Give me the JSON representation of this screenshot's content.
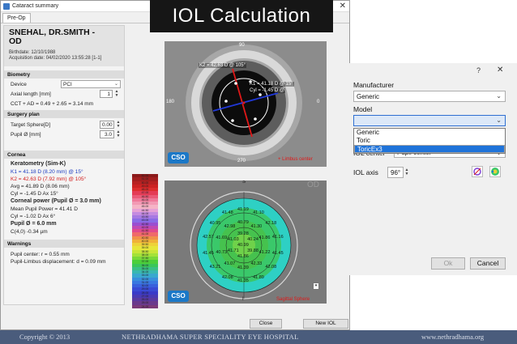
{
  "window": {
    "title": "Cataract summary",
    "close_glyph": "✕"
  },
  "tabs": [
    {
      "label": "Pre-Op"
    }
  ],
  "banner": {
    "text": "IOL Calculation"
  },
  "patient": {
    "name_line1": "SNEHAL, DR.SMITH -",
    "name_line2": "OD",
    "birthdate": "Birthdate: 12/10/1988",
    "acquisition": "Acquisition date: 04/02/2020 13:55:28 [1-1]"
  },
  "biometry": {
    "header": "Biometry",
    "device_label": "Device",
    "device_value": "PCI",
    "axial_label": "Axial length [mm]",
    "axial_value": "1",
    "cct_text": "CCT + AD = 0.49 + 2.65 = 3.14 mm"
  },
  "surgery": {
    "header": "Surgery plan",
    "target_label": "Target Sphere[D]",
    "target_value": "0.00",
    "pupil_label": "Pupil Ø [mm]",
    "pupil_value": "3.0"
  },
  "cornea": {
    "header": "Cornea",
    "keratometry_title": "Keratometry (Sim-K)",
    "k1": "K1 = 41.18 D (8.20 mm) @ 15°",
    "k2": "K2 = 42.63 D (7.92 mm) @ 105°",
    "avg": "Avg = 41.89 D (8.06 mm)",
    "cyl": "Cyl = -1.45 D Ax 15°",
    "corneal_power_title": "Corneal power (Pupil Ø = 3.0 mm)",
    "mean_pupil_power": "Mean Pupil Power = 41.41 D",
    "cyl2": "Cyl = -1.02 D Ax 6°",
    "pupil6_title": "Pupil Ø = 6.0 mm",
    "c40": "C(4,0) -0.34 µm"
  },
  "warnings": {
    "header": "Warnings",
    "pupil_center": "Pupil center: r = 0.55 mm",
    "pupil_limbus": "Pupil-Limbus displacement: d = 0.09 mm"
  },
  "top_image": {
    "k2_label": "K2 = 42.63 D @ 105°",
    "k1_label": "K1 = 41.18 D @ 15°",
    "cyl_label": "Cyl = -1.45 D @",
    "limbus_label": "+ Limbus center",
    "od_label": "OD",
    "ticks": {
      "t90": "90",
      "t0": "0",
      "t180": "180",
      "t270": "270"
    },
    "logo": "CSO"
  },
  "bottom_image": {
    "od_label": "OD",
    "sagittal_label": "Sagittal Sphere",
    "tick_top": "S",
    "tick_bottom": "I",
    "logo": "CSO",
    "map_values": [
      "40.99",
      "39.28",
      "40.24",
      "39.88",
      "41.86",
      "41.71",
      "41.03",
      "40.79",
      "41.30",
      "41.86",
      "41.22",
      "42.33",
      "41.39",
      "41.07",
      "40.73",
      "41.69",
      "42.98",
      "41.19",
      "41.10",
      "42.18",
      "41.16",
      "41.45",
      "42.08",
      "41.89",
      "41.35",
      "42.08",
      "43.21",
      "41.45",
      "42.57",
      "40.95",
      "41.48"
    ]
  },
  "scale": {
    "values": [
      "52.00",
      "51.00",
      "50.00",
      "49.00",
      "48.00",
      "47.00",
      "46.50",
      "46.00",
      "45.50",
      "45.00",
      "44.50",
      "44.00",
      "43.50",
      "43.00",
      "42.50",
      "42.00",
      "41.50",
      "41.00",
      "40.50",
      "40.00",
      "39.50",
      "39.00",
      "38.50",
      "38.00",
      "37.50",
      "37.00",
      "36.00",
      "35.00",
      "34.00",
      "33.00",
      "32.00",
      "31.00",
      "30.00",
      "29.00",
      "28.00",
      "27.00",
      "26.00",
      "25.00",
      "24.00"
    ],
    "colors": [
      "#8b1a1a",
      "#a31f1f",
      "#b82222",
      "#cc2323",
      "#dc2e2e",
      "#e43c56",
      "#ea5a78",
      "#ef7a9a",
      "#f29ab4",
      "#f5b4c6",
      "#e6a1d6",
      "#c48be0",
      "#a779e2",
      "#8a6be6",
      "#9a4fd0",
      "#c04ab4",
      "#e04a8c",
      "#ef6a6a",
      "#f1904a",
      "#f0b13a",
      "#eed23a",
      "#e6e63a",
      "#c8e63a",
      "#a4e23a",
      "#7ad83a",
      "#4ccf3a",
      "#3ac65a",
      "#3abf86",
      "#3ab8b0",
      "#3aa8cf",
      "#3a8fdc",
      "#3a78e0",
      "#3a60dc",
      "#3a4ad4",
      "#3a3ac8",
      "#4a3ab4",
      "#5a3aa0",
      "#6a3a8c",
      "#7a3a78"
    ],
    "bottom_label": "D"
  },
  "bottom_buttons": {
    "close": "Close",
    "new_iol": "New IOL"
  },
  "dialog": {
    "help_glyph": "?",
    "close_glyph": "✕",
    "manufacturer_label": "Manufacturer",
    "manufacturer_value": "Generic",
    "model_label": "Model",
    "model_value": "",
    "model_options": [
      "Generic",
      "Toric",
      "ToricEx3"
    ],
    "model_selected": "ToricEx3",
    "iol_center_label": "IOL center",
    "iol_center_value": "Pupil center",
    "iol_axis_label": "IOL axis",
    "iol_axis_value": "96°",
    "ok_label": "Ok",
    "cancel_label": "Cancel"
  },
  "footer": {
    "copyright": "Copyright © 2013",
    "hospital": "NETHRADHAMA SUPER SPECIALITY EYE HOSPITAL",
    "website": "www.nethradhama.org"
  },
  "colors": {
    "accent": "#1f73d9",
    "footer_bg": "#4a5c7c",
    "banner_bg": "#161616",
    "logo": "#1b78c7"
  }
}
